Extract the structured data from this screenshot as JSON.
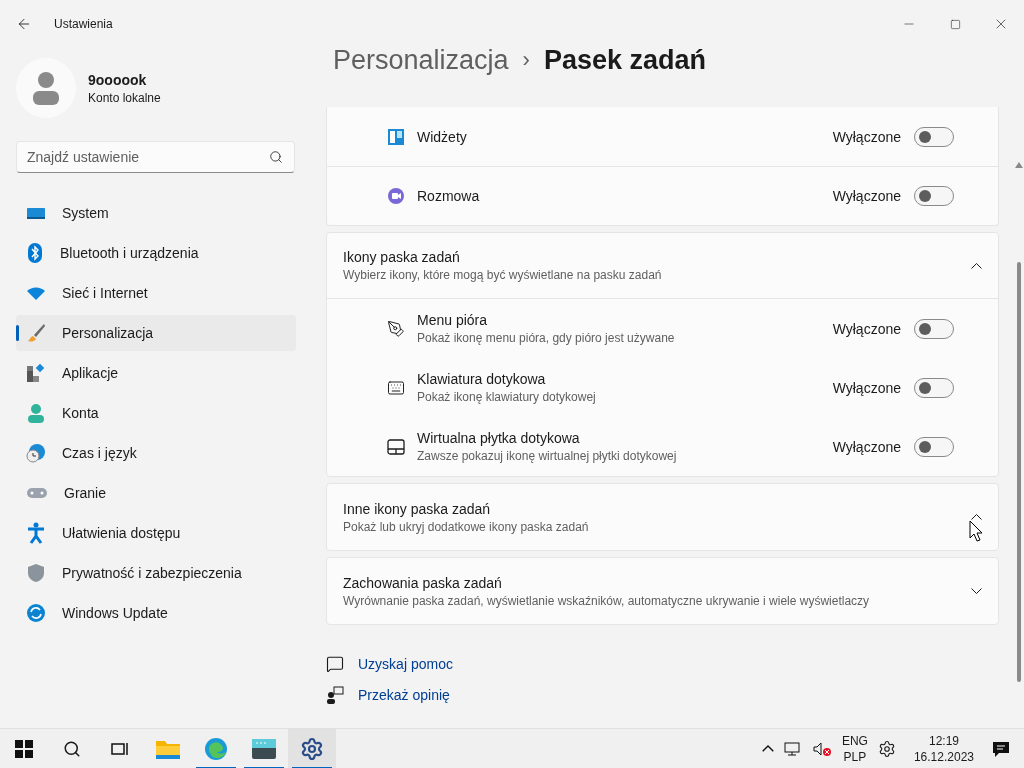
{
  "window": {
    "title": "Ustawienia"
  },
  "profile": {
    "name": "9oooook",
    "account": "Konto lokalne"
  },
  "search": {
    "placeholder": "Znajdź ustawienie"
  },
  "sidebar": {
    "items": [
      {
        "label": "System",
        "selected": false
      },
      {
        "label": "Bluetooth i urządzenia",
        "selected": false
      },
      {
        "label": "Sieć i Internet",
        "selected": false
      },
      {
        "label": "Personalizacja",
        "selected": true
      },
      {
        "label": "Aplikacje",
        "selected": false
      },
      {
        "label": "Konta",
        "selected": false
      },
      {
        "label": "Czas i język",
        "selected": false
      },
      {
        "label": "Granie",
        "selected": false
      },
      {
        "label": "Ułatwienia dostępu",
        "selected": false
      },
      {
        "label": "Prywatność i zabezpieczenia",
        "selected": false
      },
      {
        "label": "Windows Update",
        "selected": false
      }
    ]
  },
  "breadcrumb": {
    "parent": "Personalizacja",
    "separator": "›",
    "current": "Pasek zadań"
  },
  "top_card": {
    "rows": [
      {
        "label": "Widżety",
        "status": "Wyłączone",
        "on": false
      },
      {
        "label": "Rozmowa",
        "status": "Wyłączone",
        "on": false
      }
    ]
  },
  "sections": [
    {
      "title": "Ikony paska zadań",
      "subtitle": "Wybierz ikony, które mogą być wyświetlane na pasku zadań",
      "expanded": true,
      "rows": [
        {
          "label": "Menu pióra",
          "description": "Pokaż ikonę menu pióra, gdy pióro jest używane",
          "status": "Wyłączone",
          "on": false
        },
        {
          "label": "Klawiatura dotykowa",
          "description": "Pokaż ikonę klawiatury dotykowej",
          "status": "Wyłączone",
          "on": false
        },
        {
          "label": "Wirtualna płytka dotykowa",
          "description": "Zawsze pokazuj ikonę wirtualnej płytki dotykowej",
          "status": "Wyłączone",
          "on": false
        }
      ]
    },
    {
      "title": "Inne ikony paska zadań",
      "subtitle": "Pokaż lub ukryj dodatkowe ikony paska zadań",
      "expanded": true
    },
    {
      "title": "Zachowania paska zadań",
      "subtitle": "Wyrównanie paska zadań, wyświetlanie wskaźników, automatyczne ukrywanie i wiele wyświetlaczy",
      "expanded": false
    }
  ],
  "links": [
    "Uzyskaj pomoc",
    "Przekaż opinię"
  ],
  "taskbar": {
    "apps": [
      {
        "selected": false
      },
      {
        "selected": true
      },
      {
        "selected": true
      },
      {
        "selected": true
      }
    ],
    "language": "ENG",
    "layout": "PLP",
    "time": "12:19",
    "date": "16.12.2023"
  }
}
